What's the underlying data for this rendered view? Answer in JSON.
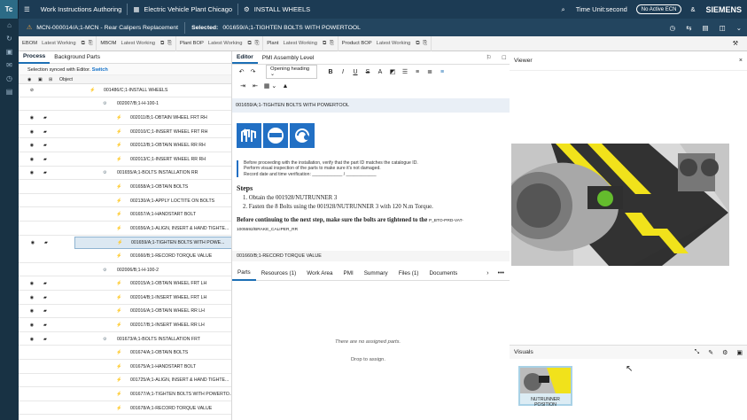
{
  "colors": {
    "top_bar": "#1c3b54",
    "accent": "#1c6fb5",
    "link": "#1572c9",
    "selected_row": "#dce8f2",
    "editor_band": "#e9eff6",
    "warning_blue": "#2270c4"
  },
  "app": {
    "logo": "Tc",
    "title": "Work Instructions Authoring",
    "crumb1": "Electric Vehicle Plant Chicago",
    "crumb2": "INSTALL WHEELS",
    "time_unit": "Time Unit:second",
    "ecn": "No Active ECN",
    "user_initial": "&",
    "brand": "SIEMENS"
  },
  "header": {
    "mcn": "MCN-000014/A;1-MCN - Rear Calipers Replacement",
    "selected_label": "Selected:",
    "selected_value": "001659/A;1-TIGHTEN BOLTS WITH POWERTOOL"
  },
  "chips": [
    {
      "name": "EBOM",
      "status": "Latest Working"
    },
    {
      "name": "MBOM",
      "status": "Latest Working"
    },
    {
      "name": "Plant BOP",
      "status": "Latest Working"
    },
    {
      "name": "Plant",
      "status": "Latest Working"
    },
    {
      "name": "Product BOP",
      "status": "Latest Working"
    }
  ],
  "left": {
    "tabs": [
      "Process",
      "Background Parts"
    ],
    "sync_text": "Selection synced with Editor.",
    "sync_link": "Switch",
    "column": "Object"
  },
  "tree": [
    {
      "name": "001486/C;1-INSTALL WHEELS",
      "vis": "hidden",
      "flag": false
    },
    {
      "name": "002007/B;1-H-100-1",
      "vis": "none",
      "flag": false
    },
    {
      "name": "002011/B;1-OBTAIN WHEEL FRT RH",
      "vis": "eye",
      "flag": true
    },
    {
      "name": "002010/C;1-INSERT WHEEL FRT RH",
      "vis": "eye",
      "flag": true
    },
    {
      "name": "002012/B;1-OBTAIN WHEEL RR RH",
      "vis": "eye",
      "flag": true
    },
    {
      "name": "002013/C;1-INSERT WHEEL RR RH",
      "vis": "eye",
      "flag": true
    },
    {
      "name": "001655/A;1-BOLTS INSTALLATION RR",
      "vis": "eye",
      "flag": true
    },
    {
      "name": "001658/A;1-OBTAIN BOLTS",
      "vis": "none",
      "flag": false
    },
    {
      "name": "002130/A;1-APPLY LOCTITE ON BOLTS",
      "vis": "none",
      "flag": false
    },
    {
      "name": "001657/A;1-HANDSTART BOLT",
      "vis": "none",
      "flag": false
    },
    {
      "name": "001656/A;1-ALIGN, INSERT & HAND TIGHTE...",
      "vis": "none",
      "flag": false
    },
    {
      "name": "001659/A;1-TIGHTEN BOLTS WITH POWE...",
      "vis": "eye",
      "flag": true,
      "selected": true
    },
    {
      "name": "001660/B;1-RECORD TORQUE VALUE",
      "vis": "none",
      "flag": false
    },
    {
      "name": "002006/B;1-H-100-2",
      "vis": "none",
      "flag": false
    },
    {
      "name": "002015/A;1-OBTAIN WHEEL FRT LH",
      "vis": "eye",
      "flag": true
    },
    {
      "name": "002014/B;1-INSERT WHEEL FRT LH",
      "vis": "eye",
      "flag": true
    },
    {
      "name": "002016/A;1-OBTAIN WHEEL RR LH",
      "vis": "eye",
      "flag": true
    },
    {
      "name": "002017/B;1-INSERT WHEEL RR LH",
      "vis": "eye",
      "flag": true
    },
    {
      "name": "001673/A;1-BOLTS INSTALLATION FRT",
      "vis": "eye",
      "flag": true
    },
    {
      "name": "001674/A;1-OBTAIN BOLTS",
      "vis": "none",
      "flag": false
    },
    {
      "name": "001675/A;1-HANDSTART BOLT",
      "vis": "none",
      "flag": false
    },
    {
      "name": "001725/A;1-ALIGN, INSERT & HAND TIGHTE...",
      "vis": "none",
      "flag": false
    },
    {
      "name": "001677/A;1-TIGHTEN BOLTS WITH POWERTO...",
      "vis": "none",
      "flag": false
    },
    {
      "name": "001678/A;1-RECORD TORQUE VALUE",
      "vis": "none",
      "flag": false
    }
  ],
  "editor": {
    "tabs": [
      "Editor",
      "PMI Assembly Level"
    ],
    "heading": "Opening heading",
    "band": "001659/A;1-TIGHTEN BOLTS WITH POWERTOOL",
    "warning": [
      "Before proceeding with the installation, verify that the part ID matches the catalogue ID.",
      "Perform visual inspection of the parts to make sure it's not damaged.",
      "Record date and time verification: ____________ / ____________"
    ],
    "steps_title": "Steps",
    "step1": "1. Obtain the 001928/NUTRUNNER 3",
    "step2": "2. Fasten the 8 Bolts using the 001928/NUTRUNNER 3  with 120 N.m Torque.",
    "continue": "Before continuing to the next step, make sure the bolts are tightened to the",
    "continue_ref": "P_BTO-PRD-VAT-1005592/BRAKE_CALIPER_RR",
    "next": "001660/B;1-RECORD TORQUE VALUE"
  },
  "bottom": {
    "tabs": [
      "Parts",
      "Resources (1)",
      "Work Area",
      "PMI",
      "Summary",
      "Files (1)",
      "Documents"
    ],
    "empty1": "There are no assigned parts.",
    "empty2": "Drop to assign."
  },
  "viewer": {
    "title": "Viewer",
    "visuals": "Visuals",
    "thumb": "NUTRUNNER POSITION"
  }
}
